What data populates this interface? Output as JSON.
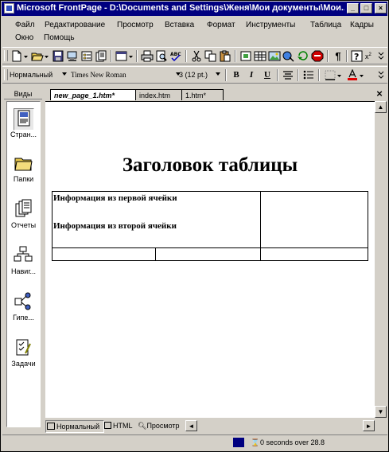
{
  "window": {
    "title": "Microsoft FrontPage - D:\\Documents and Settings\\Женя\\Мои документы\\Мои...",
    "minimize": "_",
    "maximize": "□",
    "close": "×"
  },
  "menu": {
    "row1": [
      "Файл",
      "Редактирование",
      "Просмотр",
      "Вставка",
      "Формат",
      "Инструменты",
      "Таблица",
      "Кадры"
    ],
    "row2": [
      "Окно",
      "Помощь"
    ]
  },
  "format_toolbar": {
    "style": "Нормальный",
    "font": "Times New Roman",
    "size": "3  (12 pt.)",
    "bold": "B",
    "italic": "I",
    "underline": "U"
  },
  "views_bar": {
    "header": "Виды",
    "items": [
      {
        "label": "Стран...",
        "icon": "page-view-icon",
        "selected": true
      },
      {
        "label": "Папки",
        "icon": "folder-icon",
        "selected": false
      },
      {
        "label": "Отчеты",
        "icon": "reports-icon",
        "selected": false
      },
      {
        "label": "Навиг...",
        "icon": "navigation-icon",
        "selected": false
      },
      {
        "label": "Гипе...",
        "icon": "hyperlinks-icon",
        "selected": false
      },
      {
        "label": "Задачи",
        "icon": "tasks-icon",
        "selected": false
      }
    ]
  },
  "doc_tabs": [
    {
      "label": "new_page_1.htm*",
      "active": true
    },
    {
      "label": "index.htm",
      "active": false
    },
    {
      "label": "1.htm*",
      "active": false
    }
  ],
  "document": {
    "heading": "Заголовок таблицы",
    "cell1_line1": "Информация из первой ячейки",
    "cell1_line2": "Информация из второй ячейки"
  },
  "view_tabs": [
    {
      "label": "Нормальный",
      "active": true
    },
    {
      "label": "HTML",
      "active": false
    },
    {
      "label": "Просмотр",
      "active": false
    }
  ],
  "status": {
    "download_time": "0 seconds over 28.8"
  },
  "colors": {
    "titlebar": "#000080",
    "face": "#d4d0c8",
    "font_color_bar": "#e00000"
  }
}
